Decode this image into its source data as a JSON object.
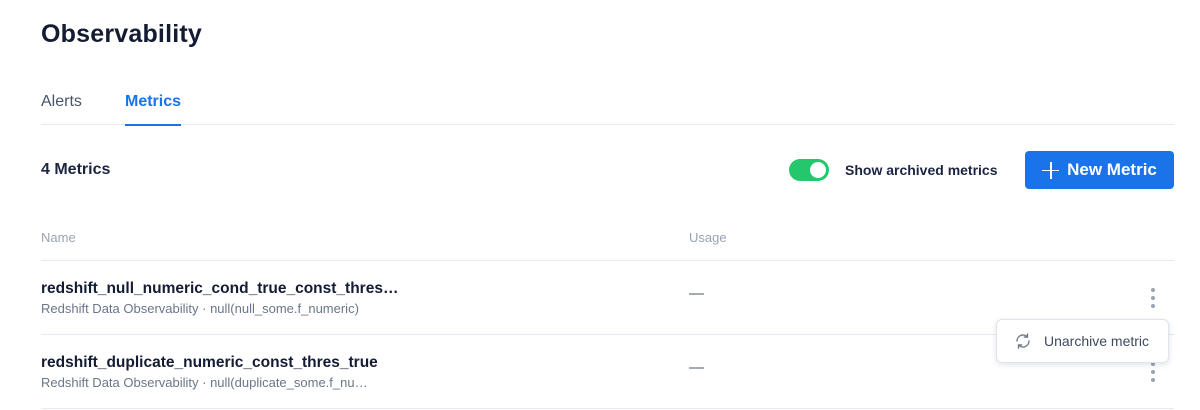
{
  "header": {
    "title": "Observability"
  },
  "tabs": [
    {
      "label": "Alerts",
      "active": false
    },
    {
      "label": "Metrics",
      "active": true
    }
  ],
  "toolbar": {
    "count_label": "4 Metrics",
    "archived_toggle_label": "Show archived metrics",
    "archived_toggle_on": true,
    "new_metric_label": "New Metric"
  },
  "table": {
    "columns": [
      "Name",
      "Usage"
    ],
    "rows": [
      {
        "name": "redshift_null_numeric_cond_true_const_thres…",
        "subtitle": "Redshift Data Observability · null(null_some.f_numeric)",
        "usage": "—"
      },
      {
        "name": "redshift_duplicate_numeric_const_thres_true",
        "subtitle": "Redshift Data Observability · null(duplicate_some.f_nu…",
        "usage": "—"
      }
    ]
  },
  "context_menu": {
    "item_label": "Unarchive metric"
  },
  "colors": {
    "accent": "#1a73e8",
    "toggle_on": "#24c76b",
    "title": "#141c33"
  }
}
